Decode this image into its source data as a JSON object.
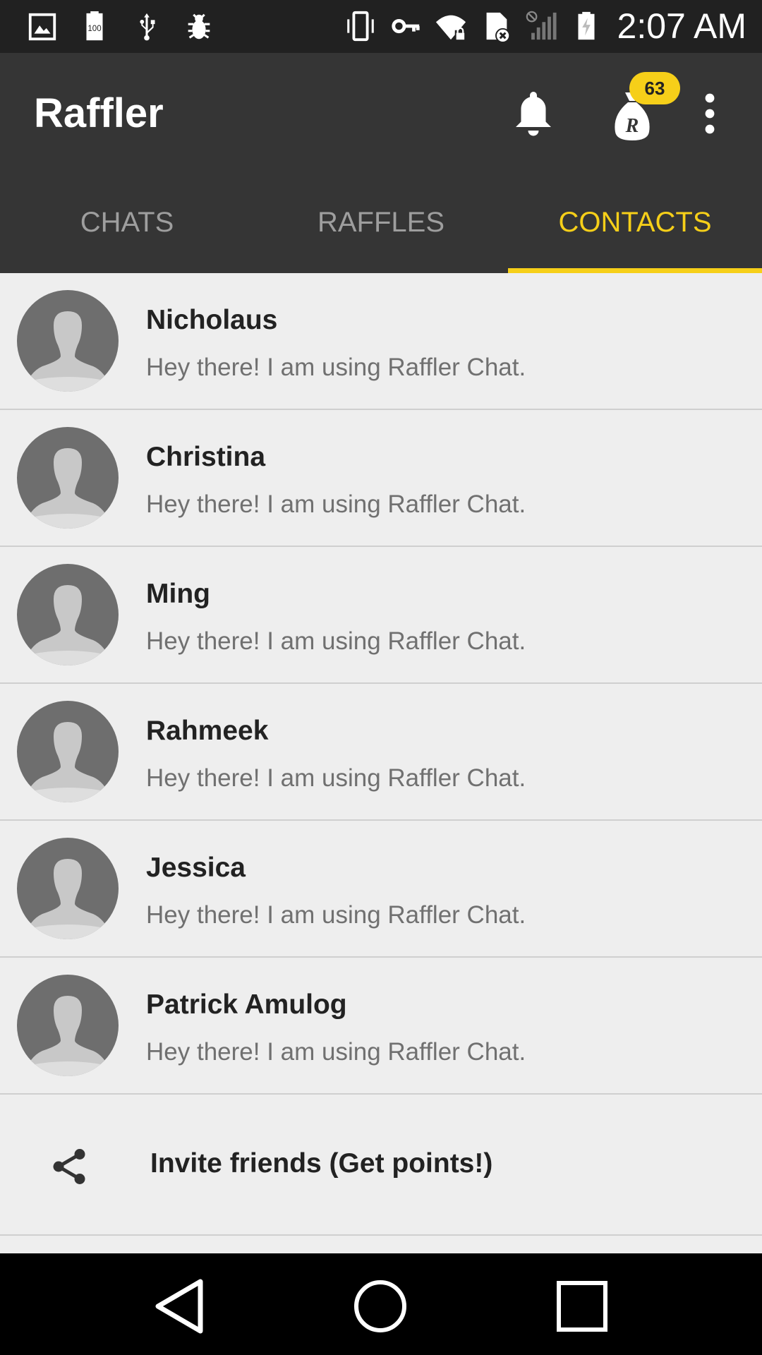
{
  "status_bar": {
    "time": "2:07 AM",
    "left_icons": [
      "image-icon",
      "battery-100-icon",
      "usb-icon",
      "bug-icon"
    ],
    "right_icons": [
      "vibrate-icon",
      "vpn-key-icon",
      "wifi-lock-icon",
      "sim-error-icon",
      "no-signal-icon",
      "battery-charging-icon"
    ]
  },
  "app_bar": {
    "title": "Raffler",
    "points_badge": "63",
    "actions": [
      "bell-icon",
      "money-bag-icon",
      "more-vert-icon"
    ]
  },
  "tabs": [
    {
      "label": "CHATS",
      "active": false
    },
    {
      "label": "RAFFLES",
      "active": false
    },
    {
      "label": "CONTACTS",
      "active": true
    }
  ],
  "contacts": [
    {
      "name": "Nicholaus",
      "status": "Hey there! I am using Raffler Chat."
    },
    {
      "name": "Christina",
      "status": "Hey there! I am using Raffler Chat."
    },
    {
      "name": "Ming",
      "status": "Hey there! I am using Raffler Chat."
    },
    {
      "name": "Rahmeek",
      "status": "Hey there! I am using Raffler Chat."
    },
    {
      "name": "Jessica",
      "status": "Hey there! I am using Raffler Chat."
    },
    {
      "name": "Patrick Amulog",
      "status": "Hey there! I am using Raffler Chat."
    }
  ],
  "invite": {
    "label": "Invite friends (Get points!)",
    "icon": "share-icon"
  },
  "colors": {
    "accent": "#f6cf19",
    "app_bar": "#353535",
    "status_bar": "#212121",
    "background": "#eeeeee"
  }
}
